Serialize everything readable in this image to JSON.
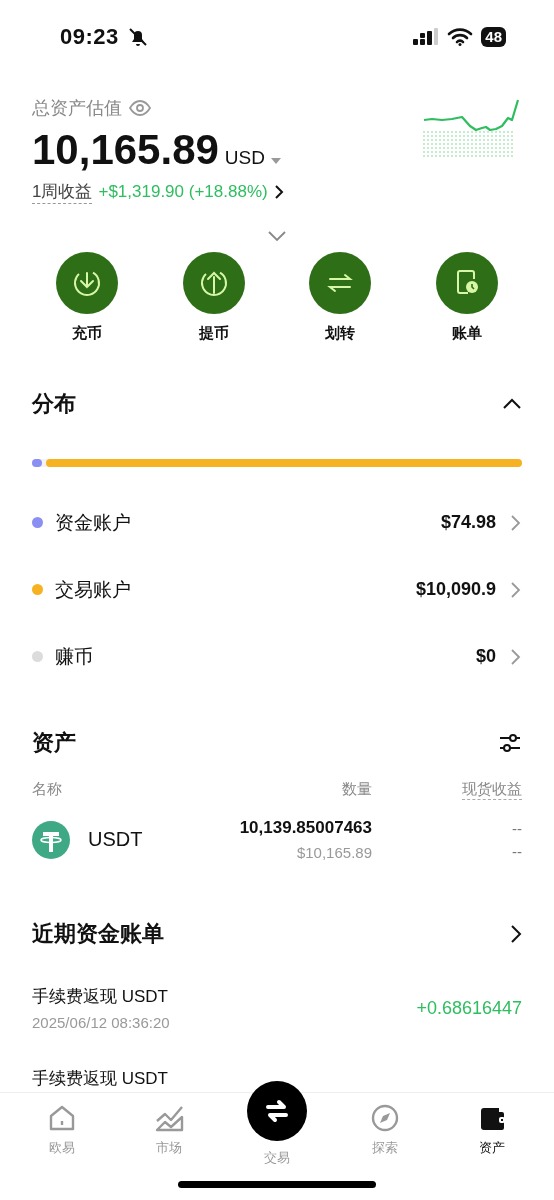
{
  "status_bar": {
    "time": "09:23",
    "battery": "48"
  },
  "summary": {
    "title": "总资产估值",
    "amount": "10,165.89",
    "currency": "USD",
    "period_label": "1周收益",
    "pnl": "+$1,319.90 (+18.88%)"
  },
  "actions": [
    {
      "label": "充币",
      "kind": "deposit"
    },
    {
      "label": "提币",
      "kind": "withdraw"
    },
    {
      "label": "划转",
      "kind": "transfer"
    },
    {
      "label": "账单",
      "kind": "bill"
    }
  ],
  "distribution": {
    "title": "分布",
    "expanded": true,
    "accounts": [
      {
        "name": "资金账户",
        "value": "$74.98",
        "color": "#8b8ff3",
        "level": 0.025
      },
      {
        "name": "交易账户",
        "value": "$10,090.9",
        "color": "#f6b220",
        "level": 0.975
      },
      {
        "name": "赚币",
        "value": "$0",
        "color": "#dcdcdc"
      }
    ]
  },
  "assets": {
    "title": "资产",
    "columns": [
      "名称",
      "数量",
      "现货收益"
    ],
    "rows": [
      {
        "coin": "USDT",
        "amount": "10,139.85007463",
        "value": "$10,165.89",
        "pnl": "--",
        "pnl_rate": "--"
      }
    ]
  },
  "ledger": {
    "title": "近期资金账单",
    "rows": [
      {
        "title": "手续费返现 USDT",
        "time": "2025/06/12 08:36:20",
        "amount": "+0.68616447"
      },
      {
        "title": "手续费返现 USDT"
      }
    ]
  },
  "tab_bar": [
    {
      "label": "欧易",
      "kind": "home",
      "selected": false
    },
    {
      "label": "市场",
      "kind": "market",
      "selected": false
    },
    {
      "label": "交易",
      "kind": "trade",
      "selected": false
    },
    {
      "label": "探索",
      "kind": "explore",
      "selected": false
    },
    {
      "label": "资产",
      "kind": "wallet",
      "selected": true
    }
  ]
}
